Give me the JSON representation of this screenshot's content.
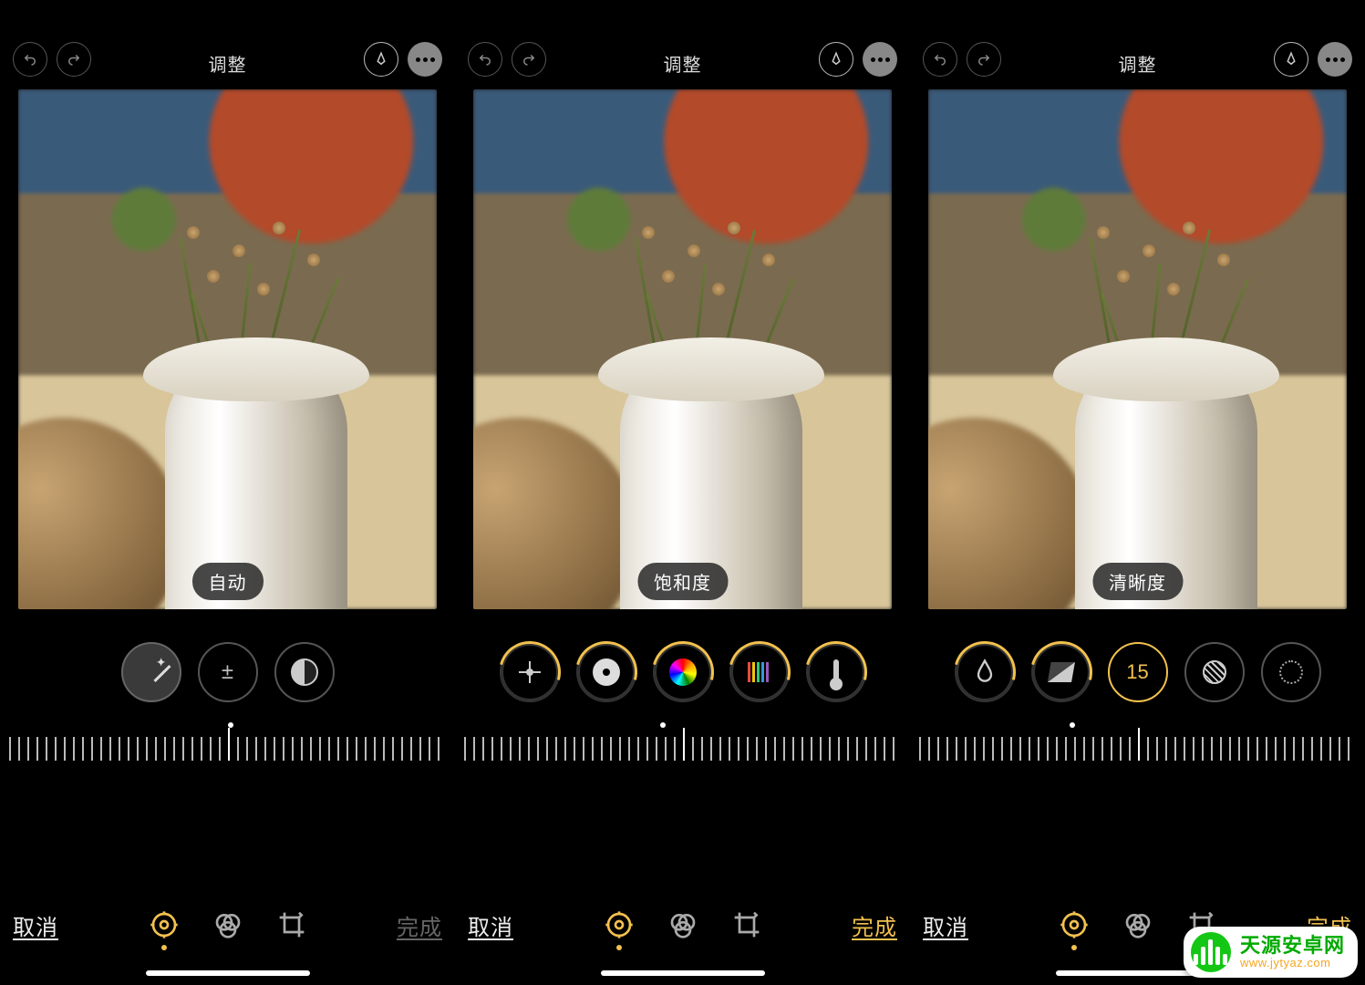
{
  "panes": [
    {
      "title": "调整",
      "adjust_label": "自动",
      "done_style": "done-dim",
      "done_label": "完成",
      "cancel_label": "取消",
      "ruler_dot_left": "50%",
      "dials": [
        {
          "name": "wand-dial",
          "icon": "wand",
          "active": true,
          "ring": false
        },
        {
          "name": "exposure-dial",
          "icon": "plusminus",
          "text": "±",
          "active": false,
          "ring": false
        },
        {
          "name": "contrast-dial",
          "icon": "contrast-ic",
          "active": false,
          "ring": false
        }
      ]
    },
    {
      "title": "调整",
      "adjust_label": "饱和度",
      "done_style": "done-gold",
      "done_label": "完成",
      "cancel_label": "取消",
      "ruler_dot_left": "45%",
      "dials": [
        {
          "name": "brilliance-dial",
          "icon": "sun-ic",
          "active": false,
          "ring": true
        },
        {
          "name": "highlights-dial",
          "icon": "disc-ic",
          "active": false,
          "ring": true
        },
        {
          "name": "saturation-dial",
          "icon": "rainbow-ic",
          "active": false,
          "ring": true
        },
        {
          "name": "vibrance-dial",
          "icon": "bars-ic",
          "active": false,
          "ring": true
        },
        {
          "name": "warmth-dial",
          "icon": "thermo-ic",
          "active": false,
          "ring": true
        }
      ]
    },
    {
      "title": "调整",
      "adjust_label": "清晰度",
      "done_style": "done-gold",
      "done_label": "完成",
      "cancel_label": "取消",
      "ruler_dot_left": "35%",
      "dials": [
        {
          "name": "tint-dial",
          "icon": "drop-svg",
          "active": false,
          "ring": true
        },
        {
          "name": "sharpness-dial",
          "icon": "tri-ic",
          "active": false,
          "ring": true
        },
        {
          "name": "definition-dial",
          "icon": "value",
          "text": "15",
          "active": false,
          "ring": false,
          "value": true
        },
        {
          "name": "noise-dial",
          "icon": "diag-ic",
          "active": false,
          "ring": false
        },
        {
          "name": "vignette-dial",
          "icon": "dots-ring",
          "active": false,
          "ring": false
        }
      ]
    }
  ],
  "watermark": {
    "title": "天源安卓网",
    "url": "www.jytyaz.com"
  }
}
